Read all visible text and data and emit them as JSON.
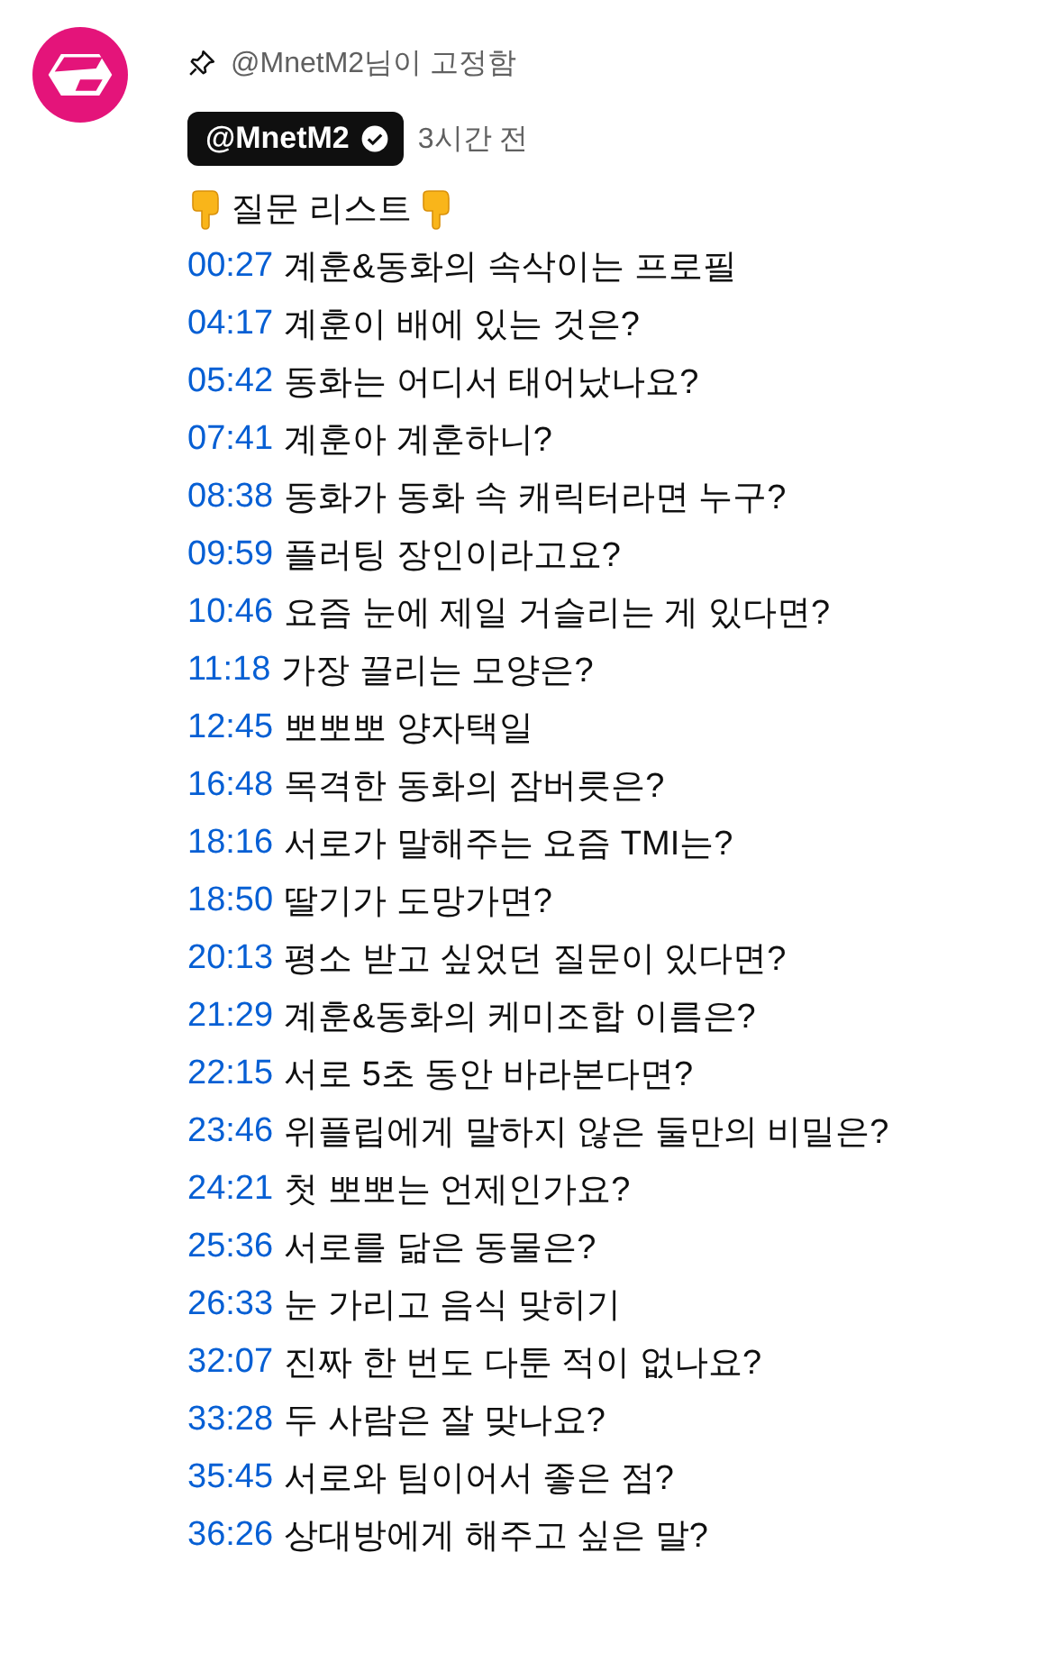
{
  "comment": {
    "pinned_label": "@MnetM2님이 고정함",
    "author": {
      "handle": "@MnetM2",
      "verified": true
    },
    "time": "3시간 전",
    "heading": "질문 리스트",
    "chapters": [
      {
        "time": "00:27",
        "title": "계훈&동화의 속삭이는 프로필"
      },
      {
        "time": "04:17",
        "title": "계훈이 배에 있는 것은?"
      },
      {
        "time": "05:42",
        "title": "동화는 어디서 태어났나요?"
      },
      {
        "time": "07:41",
        "title": "계훈아 계훈하니?"
      },
      {
        "time": "08:38",
        "title": "동화가 동화 속 캐릭터라면 누구?"
      },
      {
        "time": "09:59",
        "title": "플러팅 장인이라고요?"
      },
      {
        "time": "10:46",
        "title": "요즘 눈에 제일 거슬리는 게 있다면?"
      },
      {
        "time": "11:18",
        "title": "가장 끌리는 모양은?"
      },
      {
        "time": "12:45",
        "title": "뽀뽀뽀 양자택일"
      },
      {
        "time": "16:48",
        "title": "목격한 동화의 잠버릇은?"
      },
      {
        "time": "18:16",
        "title": "서로가 말해주는 요즘 TMI는?"
      },
      {
        "time": "18:50",
        "title": "딸기가 도망가면?"
      },
      {
        "time": "20:13",
        "title": "평소 받고 싶었던 질문이 있다면?"
      },
      {
        "time": "21:29",
        "title": "계훈&동화의 케미조합 이름은?"
      },
      {
        "time": "22:15",
        "title": "서로 5초 동안 바라본다면?"
      },
      {
        "time": "23:46",
        "title": "위플립에게 말하지 않은 둘만의 비밀은?"
      },
      {
        "time": "24:21",
        "title": "첫 뽀뽀는 언제인가요?"
      },
      {
        "time": "25:36",
        "title": "서로를 닮은 동물은?"
      },
      {
        "time": "26:33",
        "title": "눈 가리고 음식 맞히기"
      },
      {
        "time": "32:07",
        "title": "진짜 한 번도 다툰 적이 없나요?"
      },
      {
        "time": "33:28",
        "title": "두 사람은 잘 맞나요?"
      },
      {
        "time": "35:45",
        "title": "서로와 팀이어서 좋은 점?"
      },
      {
        "time": "36:26",
        "title": "상대방에게 해주고 싶은 말?"
      }
    ]
  }
}
